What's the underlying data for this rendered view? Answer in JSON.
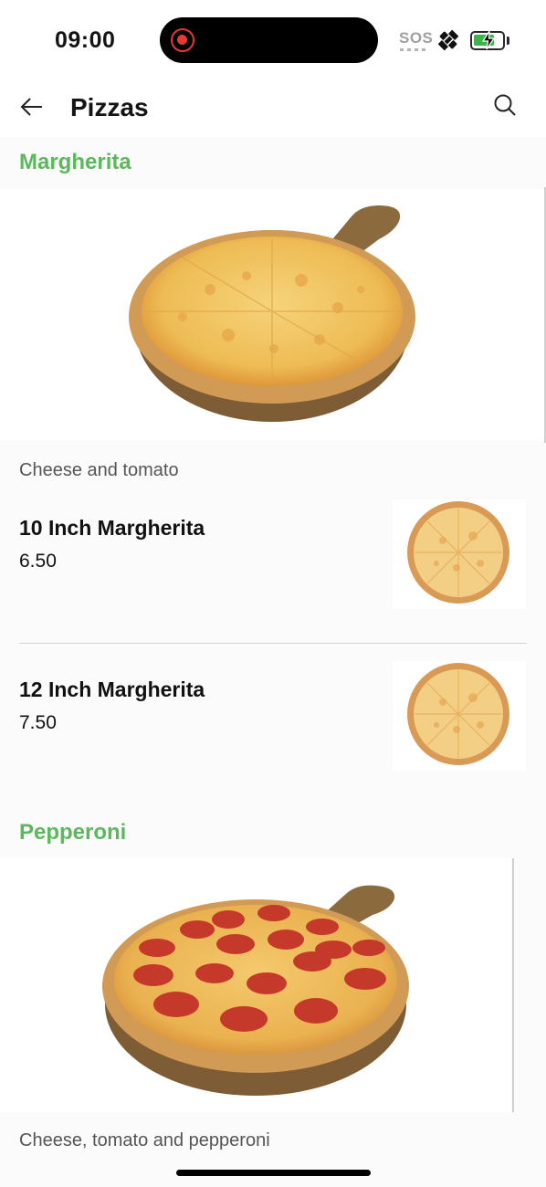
{
  "status_bar": {
    "time": "09:00",
    "sos": "SOS",
    "battery_level": 0.75,
    "icons": [
      "record-icon",
      "satellite-icon",
      "battery-charging-icon"
    ]
  },
  "header": {
    "title": "Pizzas",
    "back_icon": "arrow-left-icon",
    "search_icon": "search-icon"
  },
  "sections": [
    {
      "title": "Margherita",
      "description": "Cheese and tomato",
      "items": [
        {
          "name": "10 Inch Margherita",
          "price": "6.50"
        },
        {
          "name": "12 Inch Margherita",
          "price": "7.50"
        }
      ]
    },
    {
      "title": "Pepperoni",
      "description": "Cheese, tomato and pepperoni"
    }
  ],
  "colors": {
    "accent": "#5cb85c",
    "battery": "#39b54a",
    "recording": "#e53935"
  }
}
